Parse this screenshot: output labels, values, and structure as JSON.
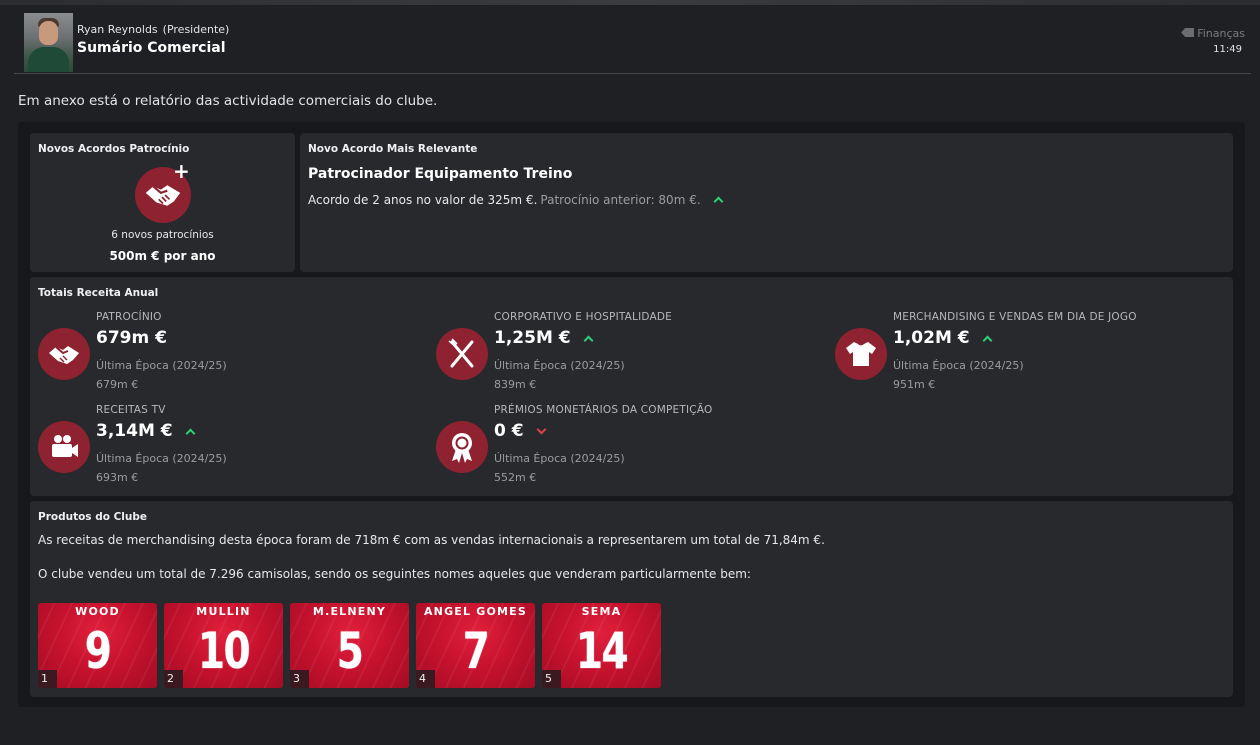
{
  "header": {
    "sender_name": "Ryan Reynolds",
    "sender_role": "(Presidente)",
    "title": "Sumário Comercial",
    "tag": "Finanças",
    "time": "11:49"
  },
  "intro": "Em anexo está o relatório das actividade comerciais do clube.",
  "new_sponsorships": {
    "title": "Novos Acordos Patrocínio",
    "count_text": "6 novos patrocínios",
    "value_text": "500m € por ano"
  },
  "relevant_deal": {
    "title": "Novo Acordo Mais Relevante",
    "name": "Patrocinador Equipamento Treino",
    "description": "Acordo de 2 anos no valor de 325m €.",
    "previous": "Patrocínio anterior: 80m €."
  },
  "annual_revenue": {
    "title": "Totais Receita Anual",
    "items": [
      {
        "label": "PATROCÍNIO",
        "value": "679m €",
        "last_label": "Última Época (2024/25)",
        "last_value": "679m €",
        "trend": "none",
        "icon": "handshake-icon"
      },
      {
        "label": "CORPORATIVO E HOSPITALIDADE",
        "value": "1,25M €",
        "last_label": "Última Época (2024/25)",
        "last_value": "839m €",
        "trend": "up",
        "icon": "cutlery-icon"
      },
      {
        "label": "MERCHANDISING E VENDAS EM DIA DE JOGO",
        "value": "1,02M €",
        "last_label": "Última Época (2024/25)",
        "last_value": "951m €",
        "trend": "up",
        "icon": "shirt-icon"
      },
      {
        "label": "RECEITAS TV",
        "value": "3,14M €",
        "last_label": "Última Época (2024/25)",
        "last_value": "693m €",
        "trend": "up",
        "icon": "camera-icon"
      },
      {
        "label": "PRÉMIOS MONETÁRIOS DA COMPETIÇÃO",
        "value": "0 €",
        "last_label": "Última Época (2024/25)",
        "last_value": "552m €",
        "trend": "down",
        "icon": "medal-icon"
      }
    ]
  },
  "club_products": {
    "title": "Produtos do Clube",
    "line1": "As receitas de merchandising desta época foram de 718m € com as vendas internacionais a representarem um total de 71,84m €.",
    "line2": "O clube vendeu um total de 7.296 camisolas, sendo os seguintes nomes aqueles que venderam particularmente bem:",
    "shirts": [
      {
        "rank": "1",
        "name": "WOOD",
        "number": "9"
      },
      {
        "rank": "2",
        "name": "MULLIN",
        "number": "10"
      },
      {
        "rank": "3",
        "name": "M.ELNENY",
        "number": "5"
      },
      {
        "rank": "4",
        "name": "ANGEL GOMES",
        "number": "7"
      },
      {
        "rank": "5",
        "name": "SEMA",
        "number": "14"
      }
    ]
  },
  "colors": {
    "accent": "#8e2230",
    "trend_up": "#2fd175",
    "trend_down": "#e0404c",
    "shirt_red": "#c7122e"
  }
}
